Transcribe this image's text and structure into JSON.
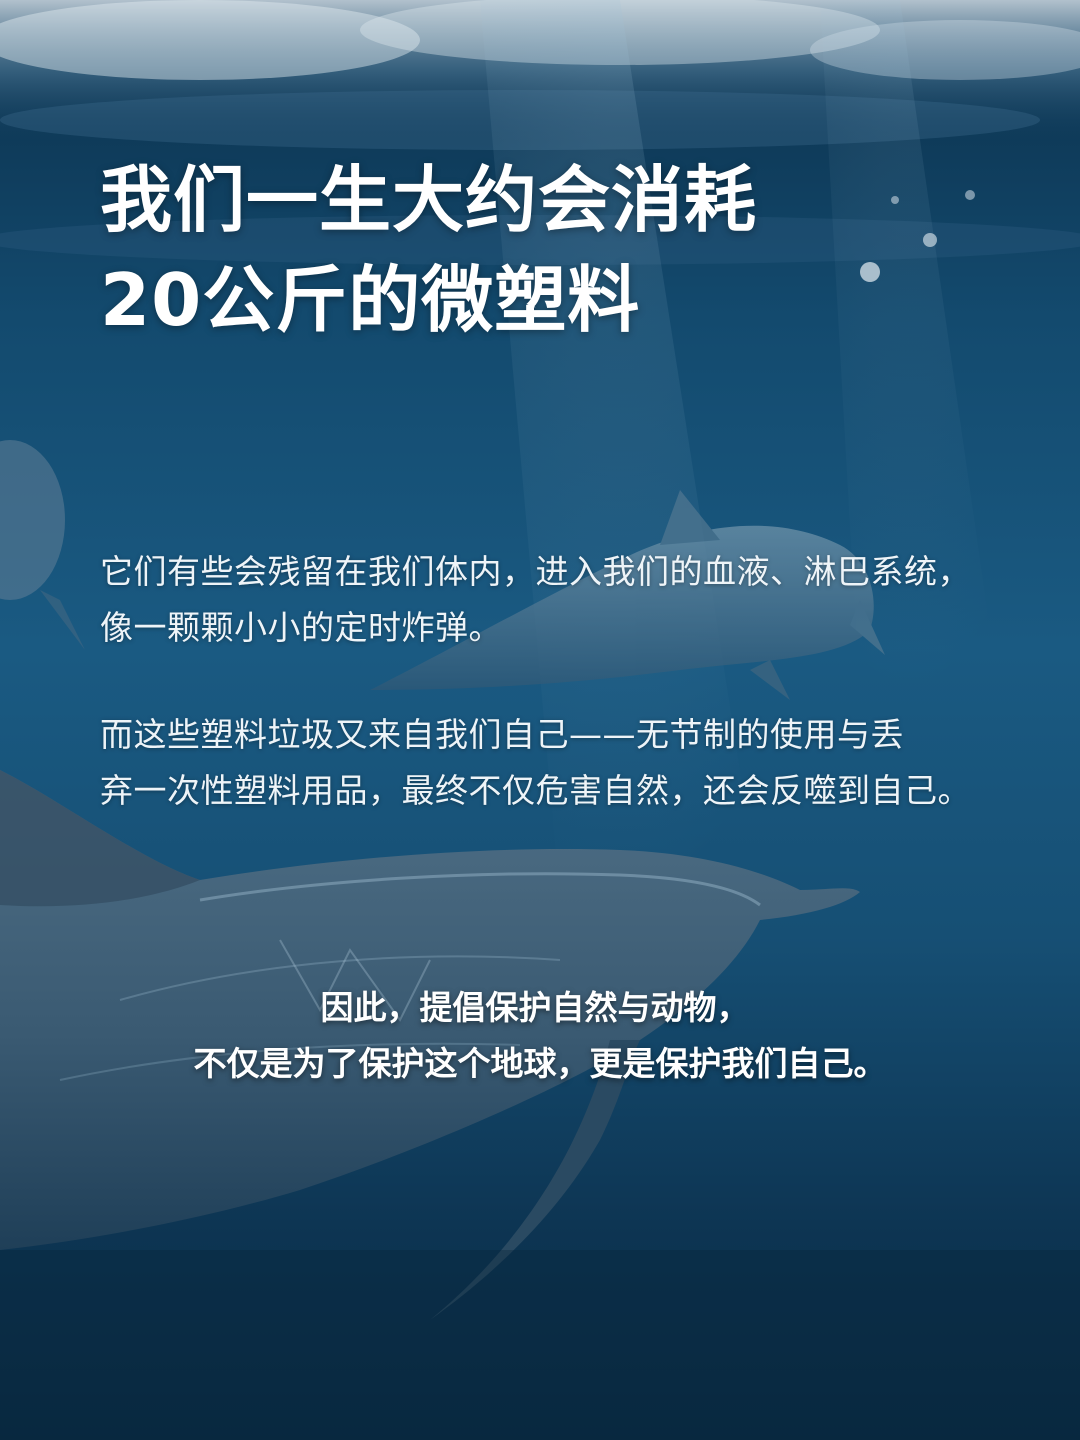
{
  "title": {
    "line1": "我们一生大约会消耗",
    "line2": "20公斤的微塑料"
  },
  "paragraph1": {
    "line1": "它们有些会残留在我们体内，进入我们的血液、淋巴系统，",
    "line2": "像一颗颗小小的定时炸弹。"
  },
  "paragraph2": {
    "line1": "而这些塑料垃圾又来自我们自己——无节制的使用与丢",
    "line2": "弃一次性塑料用品，最终不仅危害自然，还会反噬到自己。"
  },
  "conclusion": {
    "line1": "因此，提倡保护自然与动物，",
    "line2": "不仅是为了保护这个地球，更是保护我们自己。"
  },
  "colors": {
    "ocean_deep": "#0b2f4a",
    "ocean_mid": "#1a5a82",
    "text_white": "#ffffff"
  }
}
